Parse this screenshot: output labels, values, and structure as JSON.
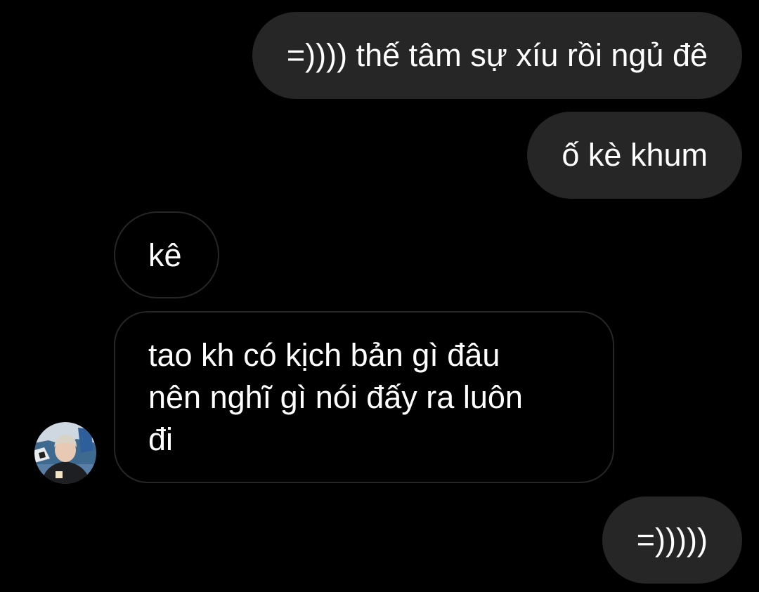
{
  "messages": [
    {
      "sender": "me",
      "text": "=)))) thế tâm sự xíu rồi ngủ đê"
    },
    {
      "sender": "me",
      "text": "ố kè khum"
    },
    {
      "sender": "other",
      "text": "kê"
    },
    {
      "sender": "other",
      "lines": [
        "tao kh có kịch bản gì đâu",
        "nên nghĩ gì nói đấy ra luôn",
        "đi"
      ]
    },
    {
      "sender": "me",
      "text": "=)))))"
    }
  ],
  "colors": {
    "background": "#000000",
    "sent_bubble": "#262626",
    "received_border": "#262626",
    "text": "#ffffff"
  },
  "avatar": {
    "icon": "user-avatar-photo"
  }
}
